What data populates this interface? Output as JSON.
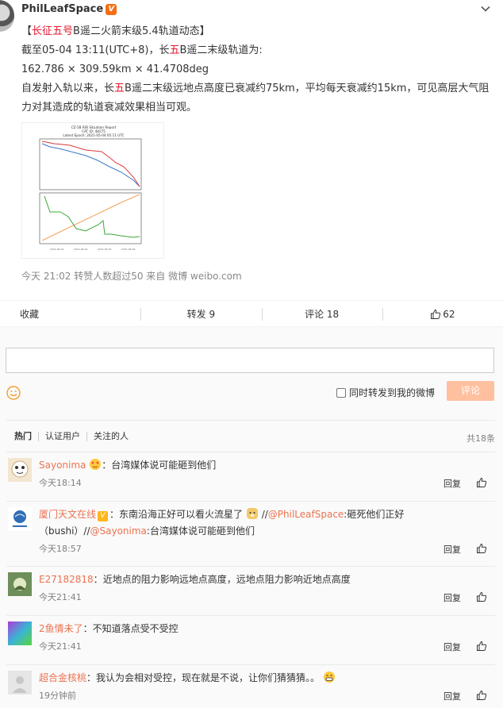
{
  "post": {
    "author": "PhilLeafSpace",
    "verified_badge": "V",
    "title_prefix": "【",
    "title_highlight": "长征五号",
    "title_rest": "B遥二火箭末级5.4轨道动态】",
    "line2_pre": "截至05-04 13:11(UTC+8)，长",
    "line2_hl": "五",
    "line2_post": "B遥二末级轨道为:",
    "line3": "162.786 × 309.59km × 41.4708deg",
    "para_pre": "自发射入轨以来，长",
    "para_hl": "五",
    "para_post": "B遥二末级远地点高度已衰减约75km，平均每天衰减约15km，可见高层大气阻力对其造成的轨道衰减效果相当可观。",
    "meta": "今天 21:02 转赞人数超过50  来自 微博 weibo.com",
    "chart_title_1": "CZ-5B R/B Situation Report",
    "chart_title_2": "CAT ID: 48275",
    "chart_title_3": "Latest Epoch: 2021-05-04 05:11 UTC"
  },
  "actions": {
    "favorite": "收藏",
    "repost": "转发 9",
    "comment": "评论 18",
    "like": "62"
  },
  "composer": {
    "repost_checkbox_label": "同时转发到我的微博",
    "submit": "评论"
  },
  "filters": {
    "hot": "热门",
    "verified": "认证用户",
    "following": "关注的人",
    "total": "共18条"
  },
  "comments": [
    {
      "user": "Sayonima",
      "sep": "：",
      "text": "台湾媒体说可能砸到他们",
      "time": "今天18:14",
      "reply": "回复"
    },
    {
      "user": "厦门天文在线",
      "text_a": "：东南沿海正好可以看火流星了",
      "text_b": "//",
      "m1": "@PhilLeafSpace",
      "text_c": ":砸死他们正好（bushi）//",
      "m2": "@Sayonima",
      "text_d": ":台湾媒体说可能砸到他们",
      "time": "今天18:57",
      "reply": "回复"
    },
    {
      "user": "E27182818",
      "sep": "：",
      "text": "近地点的阻力影响远地点高度，远地点阻力影响近地点高度",
      "time": "今天21:41",
      "reply": "回复"
    },
    {
      "user": "2鱼情未了",
      "sep": "：",
      "text": "不知道落点受不受控",
      "time": "今天21:41",
      "reply": "回复"
    },
    {
      "user": "超合金核桃",
      "sep": "：",
      "text": "我认为会相对受控，现在就是不说，让你们猜猜猜。。",
      "time": "19分钟前",
      "reply": "回复"
    }
  ]
}
